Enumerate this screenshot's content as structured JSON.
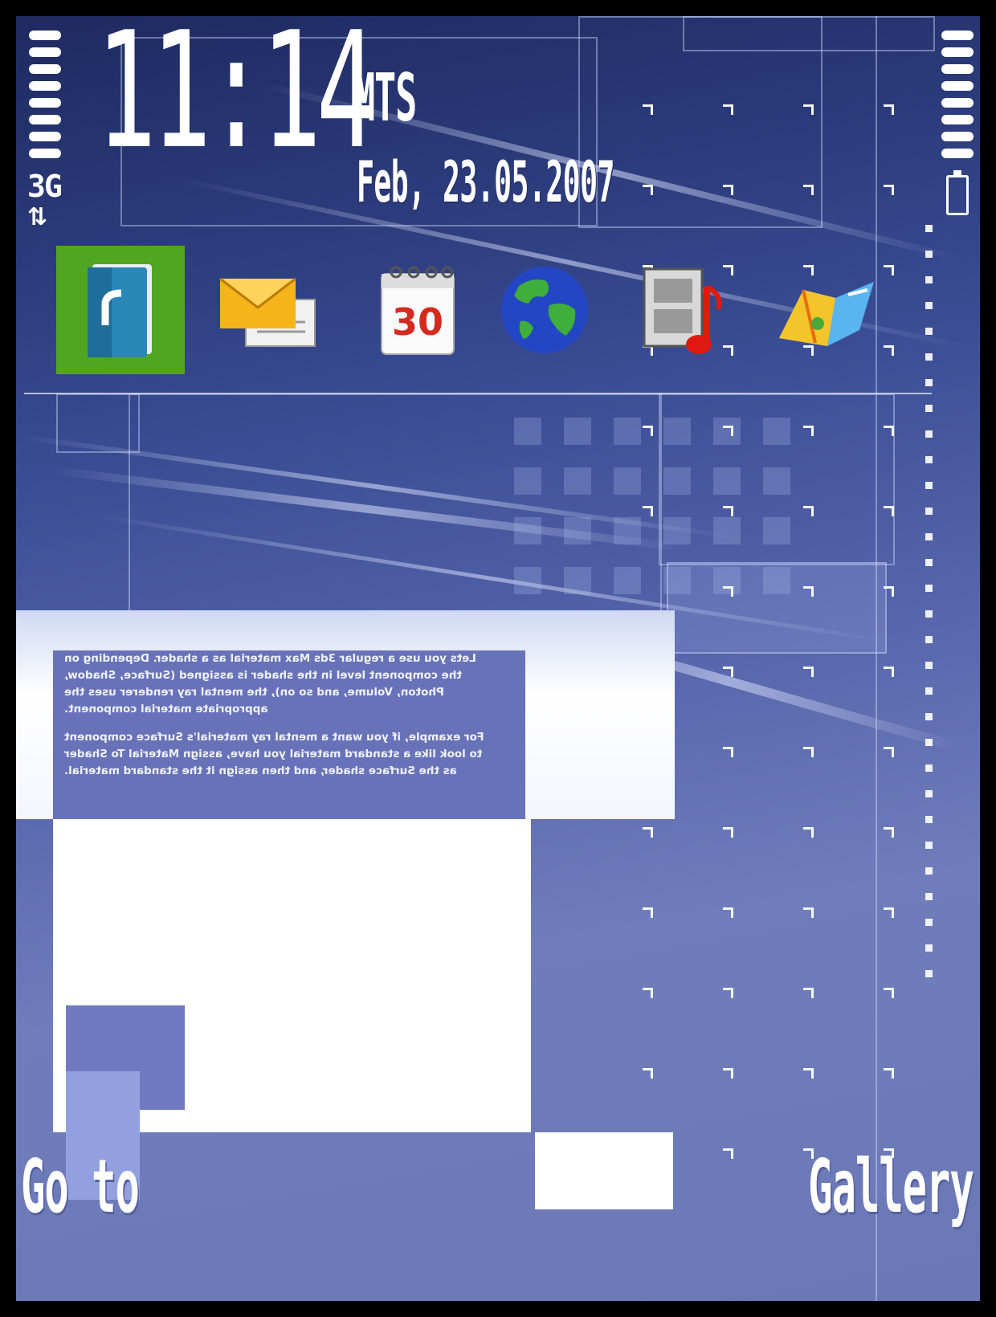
{
  "status": {
    "time": "11:14",
    "operator": "MTS",
    "date": "Feb, 23.05.2007",
    "network": "3G",
    "network_arrows": "⇅"
  },
  "app_bar": {
    "apps": [
      {
        "icon": "contacts-icon",
        "selected": true
      },
      {
        "icon": "messaging-icon"
      },
      {
        "icon": "calendar-icon",
        "label": "30"
      },
      {
        "icon": "web-icon"
      },
      {
        "icon": "media-icon"
      },
      {
        "icon": "maps-icon"
      }
    ]
  },
  "preview_text": {
    "paragraph1": "Lets you use a regular 3ds Max material as a shader. Depending on the component level in the shader is assigned (Surface, Shadow, Photon, Volume, and so on), the mental ray renderer uses the appropriate material component.",
    "paragraph2": "For example, if you want a mental ray material's Surface component to look like a standard material you have, assign Material To Shader as the Surface shader, and then assign it the standard material."
  },
  "softkeys": {
    "left": "Go to",
    "right": "Gallery"
  },
  "colors": {
    "selection": "#52a520",
    "background_top": "#1e2a60",
    "background_bottom": "#6a78b6"
  }
}
